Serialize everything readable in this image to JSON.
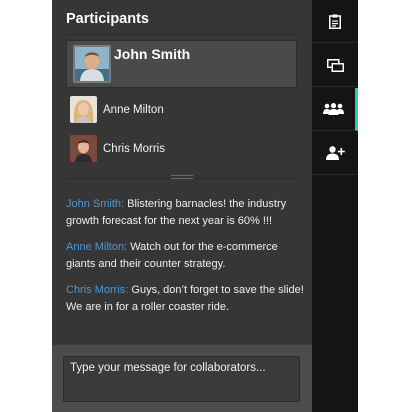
{
  "panel": {
    "title": "Participants"
  },
  "self": {
    "name": "John Smith",
    "avatar_icon": "user-photo-icon"
  },
  "participants": [
    {
      "name": "Anne Milton",
      "avatar_icon": "user-photo-icon"
    },
    {
      "name": "Chris Morris",
      "avatar_icon": "user-photo-icon"
    }
  ],
  "messages": [
    {
      "author": "John Smith:",
      "text": " Blistering barnacles! the industry growth forecast for the next year is 60% !!!"
    },
    {
      "author": "Anne Milton:",
      "text": " Watch out for the e-commerce giants and their counter strategy."
    },
    {
      "author": "Chris Morris:",
      "text": " Guys, don’t forget to save the slide! We are in for a roller coaster ride."
    }
  ],
  "composer": {
    "placeholder": "Type your message for collaborators..."
  },
  "toolbar": {
    "items": [
      {
        "icon": "clipboard-icon",
        "active": false
      },
      {
        "icon": "screens-icon",
        "active": false
      },
      {
        "icon": "participants-icon",
        "active": true
      },
      {
        "icon": "add-user-icon",
        "active": false
      }
    ]
  },
  "colors": {
    "panel_bg": "#363636",
    "toolbar_bg": "#141414",
    "author_link": "#4a98d9",
    "active_indicator": "#37c9ae"
  }
}
